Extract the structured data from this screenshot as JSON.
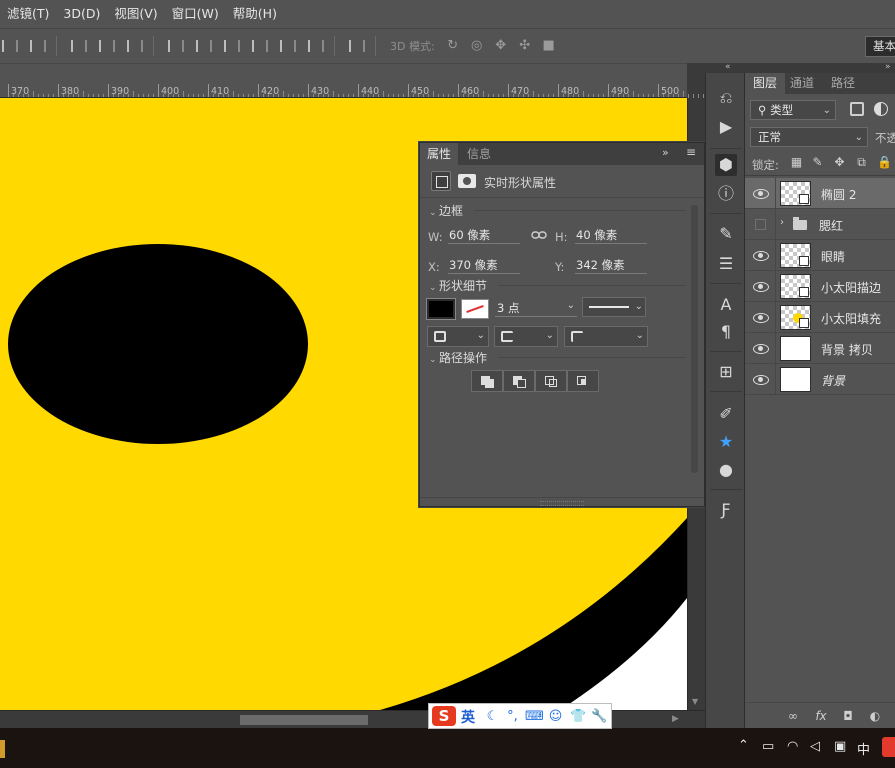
{
  "menubar": {
    "items": [
      "滤镜(T)",
      "3D(D)",
      "视图(V)",
      "窗口(W)",
      "帮助(H)"
    ]
  },
  "optionsbar": {
    "mode3d_label": "3D 模式:",
    "workspace_label": "基本"
  },
  "ruler": {
    "ticks": [
      "370",
      "380",
      "390",
      "400",
      "410",
      "420",
      "430",
      "440",
      "450",
      "460",
      "470",
      "480",
      "490",
      "500"
    ]
  },
  "canvas": {
    "background_color": "#ffd900",
    "shape_color": "#000000"
  },
  "properties": {
    "tabs": [
      "属性",
      "信息"
    ],
    "header_title": "实时形状属性",
    "section_frame": "边框",
    "w_label": "W:",
    "w_value": "60 像素",
    "h_label": "H:",
    "h_value": "40 像素",
    "x_label": "X:",
    "x_value": "370 像素",
    "y_label": "Y:",
    "y_value": "342 像素",
    "section_shape": "形状细节",
    "stroke_width": "3 点",
    "section_path": "路径操作",
    "collapse_glyph": "»",
    "menu_glyph": "≡"
  },
  "layers_panel": {
    "tabs": [
      "图层",
      "通道",
      "路径"
    ],
    "filter_label": "类型",
    "blend_mode": "正常",
    "opacity_label": "不透",
    "lock_label": "锁定:",
    "layers": [
      {
        "name": "椭圆 2",
        "visible": true,
        "selected": true,
        "thumb": "checker-shape"
      },
      {
        "name": "腮红",
        "visible": false,
        "selected": false,
        "thumb": "folder"
      },
      {
        "name": "眼睛",
        "visible": true,
        "selected": false,
        "thumb": "checker-shape"
      },
      {
        "name": "小太阳描边",
        "visible": true,
        "selected": false,
        "thumb": "checker-shape"
      },
      {
        "name": "小太阳填充",
        "visible": true,
        "selected": false,
        "thumb": "sun-shape"
      },
      {
        "name": "背景 拷贝",
        "visible": true,
        "selected": false,
        "thumb": "white"
      },
      {
        "name": "背景",
        "visible": true,
        "selected": false,
        "thumb": "white"
      }
    ]
  },
  "taskbar": {
    "ime_lang": "中"
  },
  "ime_bar": {
    "logo": "S",
    "mode": "英"
  }
}
